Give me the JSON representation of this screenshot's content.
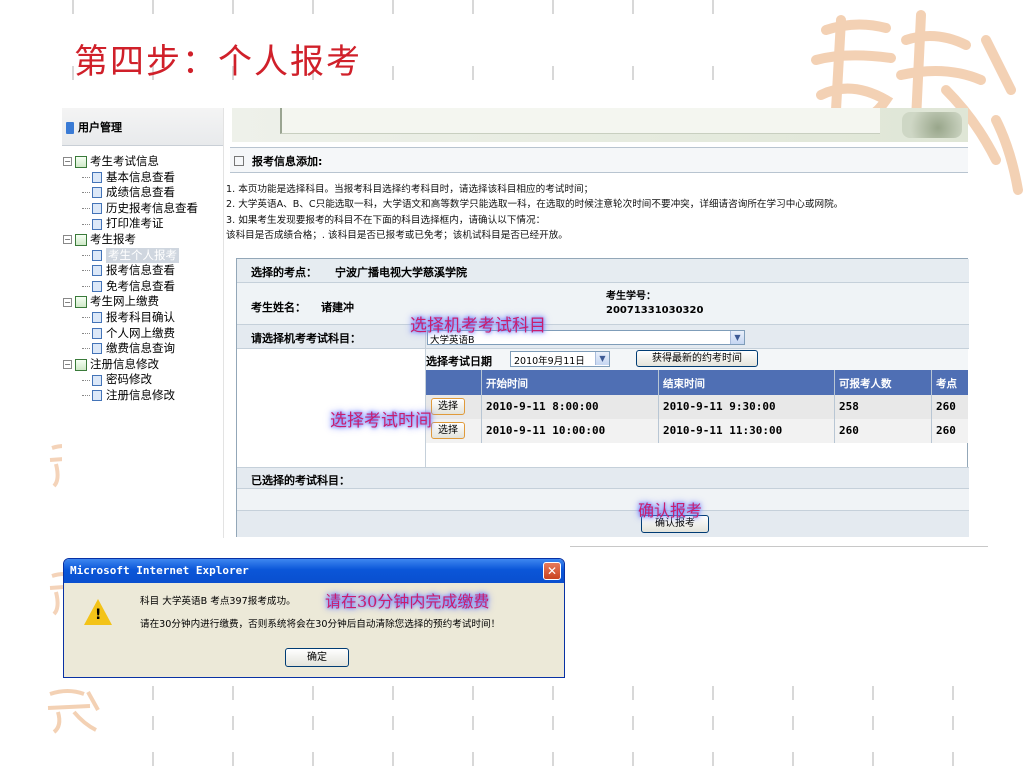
{
  "slide": {
    "title": "第四步：个人报考"
  },
  "nav": {
    "header": "用户管理",
    "tree": [
      {
        "label": "考生考试信息",
        "level": 0,
        "expanded": true
      },
      {
        "label": "基本信息查看",
        "level": 1
      },
      {
        "label": "成绩信息查看",
        "level": 1
      },
      {
        "label": "历史报考信息查看",
        "level": 1
      },
      {
        "label": "打印准考证",
        "level": 1
      },
      {
        "label": "考生报考",
        "level": 0,
        "expanded": true
      },
      {
        "label": "考生个人报考",
        "level": 1,
        "active": true
      },
      {
        "label": "报考信息查看",
        "level": 1
      },
      {
        "label": "免考信息查看",
        "level": 1
      },
      {
        "label": "考生网上缴费",
        "level": 0,
        "expanded": true
      },
      {
        "label": "报考科目确认",
        "level": 1
      },
      {
        "label": "个人网上缴费",
        "level": 1
      },
      {
        "label": "缴费信息查询",
        "level": 1
      },
      {
        "label": "注册信息修改",
        "level": 0,
        "expanded": true
      },
      {
        "label": "密码修改",
        "level": 1
      },
      {
        "label": "注册信息修改",
        "level": 1
      }
    ]
  },
  "section": {
    "title": "报考信息添加:"
  },
  "notes": {
    "n1": "1. 本页功能是选择科目。当报考科目选择约考科目时，请选择该科目相应的考试时间；",
    "n2": "2. 大学英语A、B、C只能选取一科，大学语文和高等数学只能选取一科，在选取的时候注意轮次时间不要冲突，详细请咨询所在学习中心或网院。",
    "n3": "3. 如果考生发现要报考的科目不在下面的科目选择框内，请确认以下情况：",
    "n4": "该科目是否成绩合格；. 该科目是否已报考或已免考；该机试科目是否已经开放。"
  },
  "form": {
    "site_label": "选择的考点：",
    "site_value": "宁波广播电视大学慈溪学院",
    "name_label": "考生姓名：",
    "name_value": "诸建冲",
    "id_label": "考生学号：",
    "id_value": "20071331030320",
    "course_label": "请选择机考考试科目：",
    "course_value": "大学英语B",
    "date_label": "选择考试日期",
    "date_value": "2010年9月11日",
    "latest_button": "获得最新的约考时间",
    "selected_label": "已选择的考试科目：",
    "confirm_button": "确认报考"
  },
  "grid": {
    "headers": [
      "开始时间",
      "结束时间",
      "可报考人数",
      "考点"
    ],
    "rows": [
      {
        "select": "选择",
        "start": "2010-9-11 8:00:00",
        "end": "2010-9-11 9:30:00",
        "available": "258",
        "capacity": "260"
      },
      {
        "select": "选择",
        "start": "2010-9-11 10:00:00",
        "end": "2010-9-11 11:30:00",
        "available": "260",
        "capacity": "260"
      }
    ]
  },
  "annotations": {
    "choose_subject": "选择机考考试科目",
    "choose_time": "选择考试时间",
    "confirm": "确认报考",
    "pay_notice": "请在30分钟内完成缴费"
  },
  "dialog": {
    "title": "Microsoft Internet Explorer",
    "line1": "科目 大学英语B 考点397报考成功。",
    "line2": "请在30分钟内进行缴费，否则系统将会在30分钟后自动清除您选择的预约考试时间！",
    "ok": "确定"
  },
  "colors": {
    "title_red": "#d0202a",
    "grid_header": "#4f6fb4",
    "annotation": "#c81e6e",
    "dialog_titlebar": "#0b56d8"
  }
}
